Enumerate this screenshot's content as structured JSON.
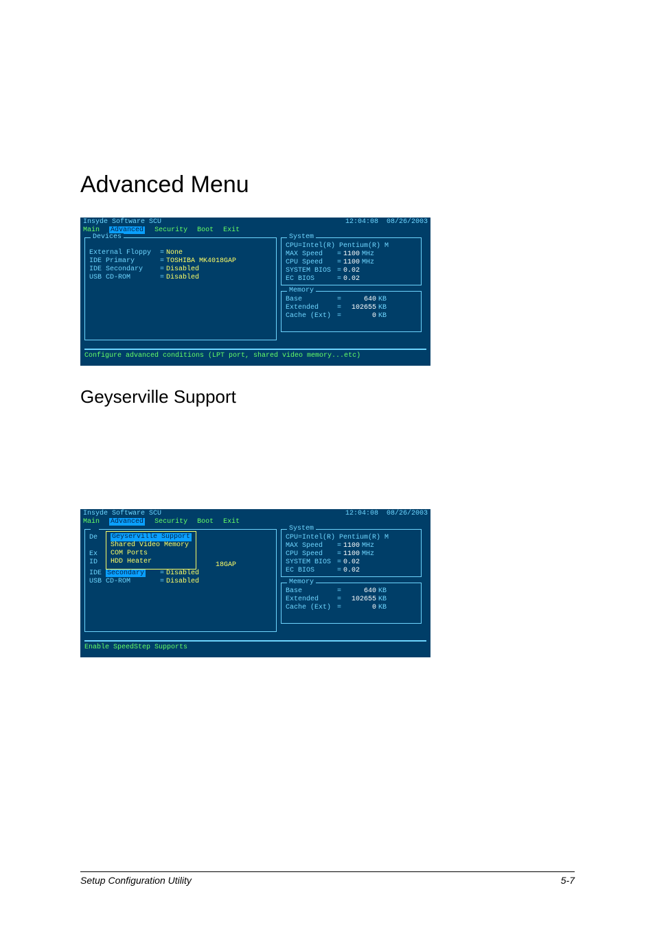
{
  "heading1": "Advanced Menu",
  "heading2": "Geyserville Support",
  "footer": {
    "left": "Setup Configuration Utility",
    "right": "5-7"
  },
  "bios": {
    "title": "Insyde Software SCU",
    "time": "12:04:08",
    "date": "08/26/2003",
    "tabs": [
      "Main",
      "Advanced",
      "Security",
      "Boot",
      "Exit"
    ],
    "tab_selected": 1,
    "devices": {
      "title": "Devices",
      "lines": [
        {
          "label": "External Floppy",
          "value": "None"
        },
        {
          "label": "IDE Primary",
          "value": "TOSHIBA MK4018GAP"
        },
        {
          "label": "IDE Secondary",
          "value": "Disabled"
        },
        {
          "label": "USB CD-ROM",
          "value": "Disabled"
        }
      ]
    },
    "system": {
      "title": "System",
      "cpu_name": "CPU=Intel(R) Pentium(R) M",
      "lines": [
        {
          "label": "MAX   Speed",
          "value": "1100",
          "unit": "MHz"
        },
        {
          "label": "CPU   Speed",
          "value": "1100",
          "unit": "MHz"
        },
        {
          "label": "SYSTEM BIOS",
          "value": "0.02",
          "unit": ""
        },
        {
          "label": "EC    BIOS",
          "value": "0.02",
          "unit": ""
        }
      ]
    },
    "memory": {
      "title": "Memory",
      "lines": [
        {
          "label": "Base",
          "value": "640",
          "unit": "KB"
        },
        {
          "label": "Extended",
          "value": "102655",
          "unit": "KB"
        },
        {
          "label": "Cache (Ext)",
          "value": "0",
          "unit": "KB"
        }
      ]
    },
    "help1": "Configure advanced conditions (LPT port, shared video memory...etc)",
    "help2": "Enable SpeedStep Supports"
  },
  "submenu": {
    "items": [
      "Geyserville Support",
      "Shared Video Memory",
      "COM Ports",
      "HDD Heater"
    ],
    "selected": 0,
    "left_peek": [
      "De",
      "Ex",
      "ID"
    ],
    "right_peek": "18GAP",
    "below": [
      {
        "label": "IDE Secondary",
        "value": "Disabled",
        "label_hl": true
      },
      {
        "label": "USB CD-ROM",
        "value": "Disabled",
        "label_hl": false
      }
    ]
  }
}
